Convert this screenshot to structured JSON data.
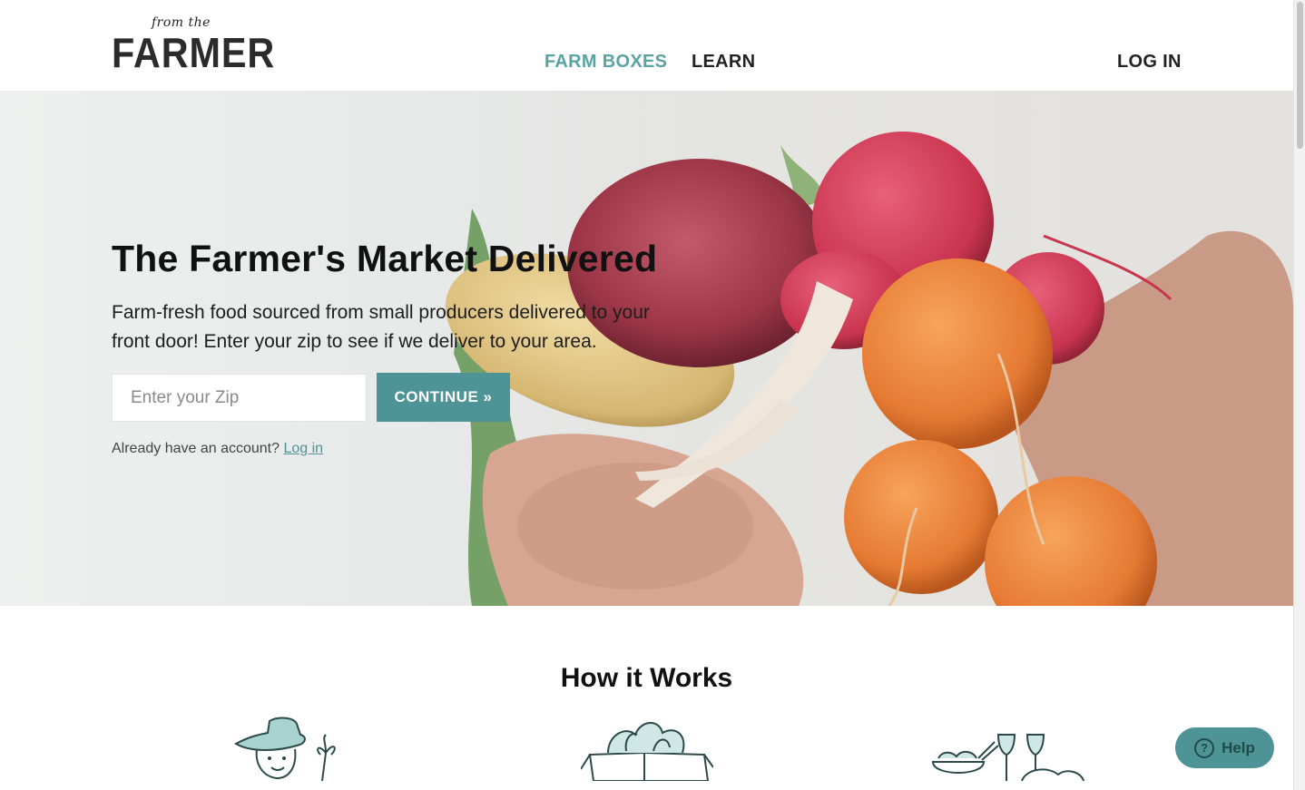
{
  "logo": {
    "small": "from the",
    "big": "FARMER"
  },
  "nav": {
    "farm_boxes": "FARM BOXES",
    "learn": "LEARN",
    "login": "LOG IN"
  },
  "hero": {
    "title": "The Farmer's Market Delivered",
    "subtitle": "Farm-fresh food sourced from small producers delivered to your front door! Enter your zip to see if we deliver to your area.",
    "zip_placeholder": "Enter your Zip",
    "zip_value": "",
    "continue_label": "CONTINUE »",
    "account_prompt": "Already have an account?",
    "account_link": "Log in"
  },
  "how": {
    "title": "How it Works"
  },
  "help": {
    "label": "Help",
    "icon": "question-circle-icon"
  },
  "colors": {
    "accent": "#4e9395",
    "nav_active": "#5aa3a3",
    "text": "#111111"
  }
}
